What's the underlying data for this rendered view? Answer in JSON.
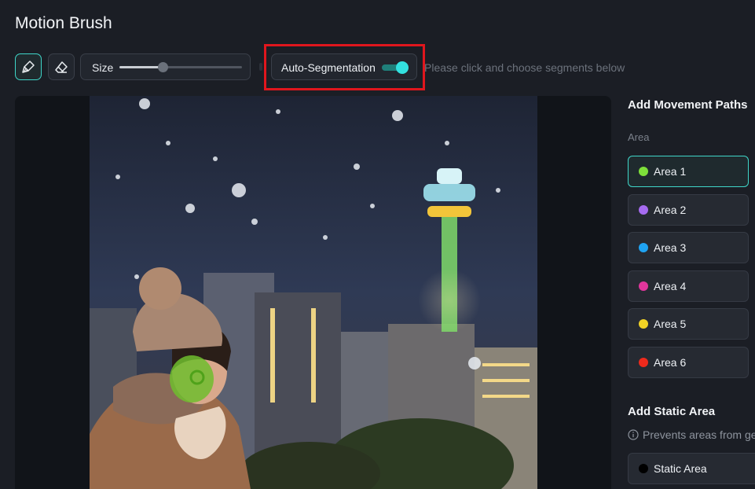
{
  "title": "Motion Brush",
  "toolbar": {
    "brush_icon": "brush-icon",
    "eraser_icon": "eraser-icon",
    "size_label": "Size",
    "size_value": 0.35,
    "autoseg_label": "Auto-Segmentation",
    "autoseg_enabled": true,
    "hint": "Please click and choose segments below"
  },
  "panel": {
    "movement_title": "Add Movement Paths",
    "area_header": "Area",
    "areas": [
      {
        "label": "Area 1",
        "color": "#7ee03a",
        "selected": true
      },
      {
        "label": "Area 2",
        "color": "#a66bf0",
        "selected": false
      },
      {
        "label": "Area 3",
        "color": "#1fa3f2",
        "selected": false
      },
      {
        "label": "Area 4",
        "color": "#e0369c",
        "selected": false
      },
      {
        "label": "Area 5",
        "color": "#f0d225",
        "selected": false
      },
      {
        "label": "Area 6",
        "color": "#ee2a1c",
        "selected": false
      }
    ],
    "static_title": "Add Static Area",
    "static_desc": "Prevents areas from ge",
    "static_item": {
      "label": "Static Area",
      "color": "#000000"
    }
  },
  "colors": {
    "accent": "#3fd6c9",
    "highlight": "#e0161d"
  }
}
